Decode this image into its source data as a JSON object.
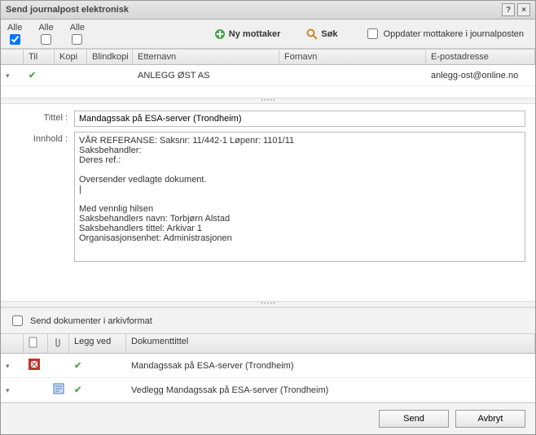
{
  "window_title": "Send journalpost elektronisk",
  "checkcols": {
    "alle1": "Alle",
    "alle2": "Alle",
    "alle3": "Alle"
  },
  "toolbar": {
    "ny_mottaker": "Ny mottaker",
    "sok": "Søk",
    "oppdater": "Oppdater mottakere i journalposten"
  },
  "recipients": {
    "headers": {
      "til": "Til",
      "kopi": "Kopi",
      "blindkopi": "Blindkopi",
      "etternavn": "Etternavn",
      "fornavn": "Fornavn",
      "epost": "E-postadresse"
    },
    "rows": [
      {
        "etternavn": "ANLEGG ØST AS",
        "fornavn": "",
        "epost": "anlegg-ost@online.no"
      }
    ]
  },
  "form": {
    "tittel_label": "Tittel :",
    "tittel_value": "Mandagssak på ESA-server (Trondheim)",
    "innhold_label": "Innhold :",
    "innhold_value": "VÅR REFERANSE: Saksnr: 11/442-1 Løpenr: 1101/11\nSaksbehandler:\nDeres ref.:\n\nOversender vedlagte dokument.\n|\n\nMed vennlig hilsen\nSaksbehandlers navn: Torbjørn Alstad\nSaksbehandlers tittel: Arkivar 1\nOrganisasjonsenhet: Administrasjonen"
  },
  "options": {
    "send_arkivformat": "Send dokumenter i arkivformat"
  },
  "docs": {
    "headers": {
      "leggved": "Legg ved",
      "dokumenttittel": "Dokumenttittel"
    },
    "rows": [
      {
        "tittel": "Mandagssak på ESA-server (Trondheim)"
      },
      {
        "tittel": "Vedlegg Mandagssak på ESA-server (Trondheim)"
      }
    ]
  },
  "buttons": {
    "send": "Send",
    "avbryt": "Avbryt"
  },
  "icons": {
    "plus": "add-circle-icon",
    "search": "magnifier-icon",
    "refresh": "refresh-icon",
    "pdf": "pdf-icon",
    "doc": "doc-icon",
    "clip": "paperclip-icon",
    "page": "page-icon"
  }
}
